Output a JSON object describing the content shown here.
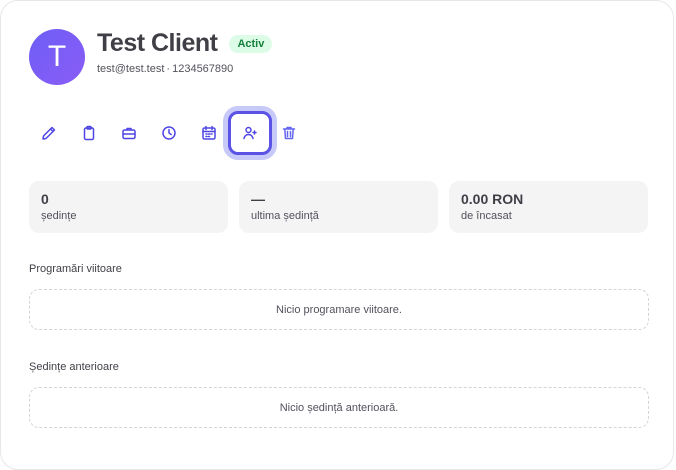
{
  "client": {
    "avatar_initial": "T",
    "name": "Test Client",
    "status": "Activ",
    "email": "test@test.test",
    "separator": "·",
    "phone": "1234567890"
  },
  "actions": [
    {
      "icon": "pencil-icon",
      "label": "edit"
    },
    {
      "icon": "clipboard-icon",
      "label": "notes"
    },
    {
      "icon": "briefcase-icon",
      "label": "services"
    },
    {
      "icon": "clock-icon",
      "label": "history"
    },
    {
      "icon": "calendar-icon",
      "label": "schedule"
    },
    {
      "icon": "user-plus-icon",
      "label": "invite",
      "active": true
    },
    {
      "icon": "trash-icon",
      "label": "delete"
    }
  ],
  "stats": [
    {
      "value": "0",
      "label": "ședințe"
    },
    {
      "value": "—",
      "label": "ultima ședință"
    },
    {
      "value": "0.00 RON",
      "label": "de încasat"
    }
  ],
  "upcoming": {
    "title": "Programări viitoare",
    "empty_text": "Nicio programare viitoare."
  },
  "past": {
    "title": "Ședințe anterioare",
    "empty_text": "Nicio ședință anterioară."
  },
  "colors": {
    "accent": "#5b52e6",
    "badge_bg": "#dcfce7",
    "badge_text": "#15803d"
  }
}
